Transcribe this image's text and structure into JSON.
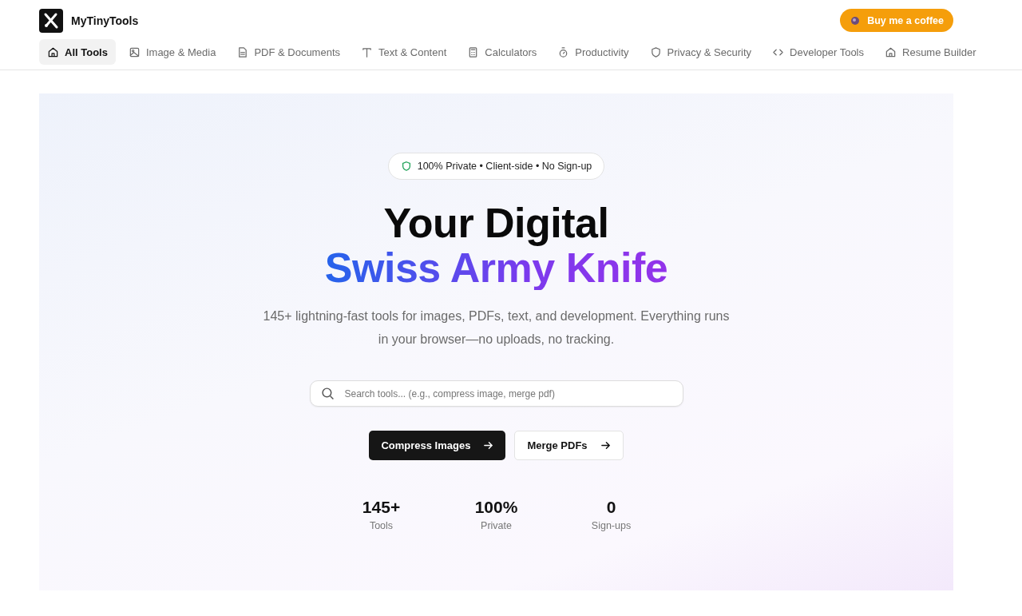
{
  "brand": {
    "name": "MyTinyTools"
  },
  "coffee_button": {
    "label": "Buy me a coffee"
  },
  "nav": [
    {
      "label": "All Tools",
      "selected": true
    },
    {
      "label": "Image & Media",
      "selected": false
    },
    {
      "label": "PDF & Documents",
      "selected": false
    },
    {
      "label": "Text & Content",
      "selected": false
    },
    {
      "label": "Calculators",
      "selected": false
    },
    {
      "label": "Productivity",
      "selected": false
    },
    {
      "label": "Privacy & Security",
      "selected": false
    },
    {
      "label": "Developer Tools",
      "selected": false
    },
    {
      "label": "Resume Builder",
      "selected": false
    }
  ],
  "hero": {
    "badge": "100% Private • Client-side • No Sign-up",
    "title_line_1": "Your Digital",
    "title_line_2": "Swiss Army Knife",
    "description": "145+ lightning-fast tools for images, PDFs, text, and development. Everything runs in your browser—no uploads, no tracking.",
    "search": {
      "placeholder": "Search tools... (e.g., compress image, merge pdf)"
    },
    "buttons": [
      {
        "label": "Compress Images",
        "kind": "primary"
      },
      {
        "label": "Merge PDFs",
        "kind": "secondary"
      }
    ],
    "stats": [
      {
        "value": "145+",
        "label": "Tools"
      },
      {
        "value": "100%",
        "label": "Private"
      },
      {
        "value": "0",
        "label": "Sign-ups"
      }
    ]
  }
}
